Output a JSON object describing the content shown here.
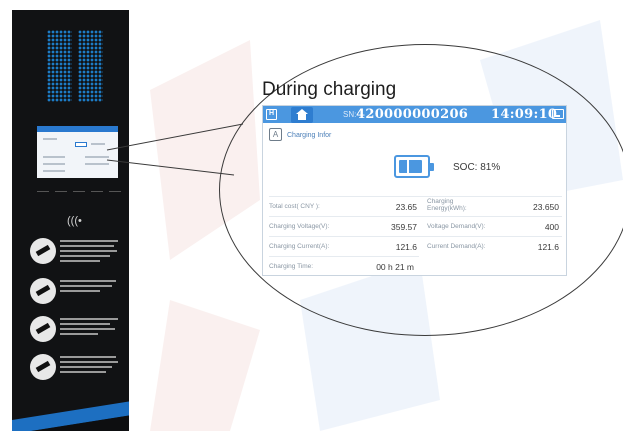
{
  "panel": {
    "instructions": [
      "step-1",
      "step-2",
      "step-3",
      "step-4"
    ]
  },
  "callout": {
    "title": "During charging"
  },
  "hmi": {
    "sn_label": "SN:",
    "serial_number": "420000000206",
    "time": "14:09:10",
    "section_title": "Charging Infor",
    "soc_label": "SOC:",
    "soc_value": "81%",
    "soc_fraction": 0.81,
    "fields": {
      "total_cost_label": "Total cost( CNY ):",
      "total_cost_value": "23.65",
      "charging_energy_label": "Charging Energy(kWh):",
      "charging_energy_value": "23.650",
      "charging_voltage_label": "Charging Voltage(V):",
      "charging_voltage_value": "359.57",
      "voltage_demand_label": "Voltage Demand(V):",
      "voltage_demand_value": "400",
      "charging_current_label": "Charging Current(A):",
      "charging_current_value": "121.6",
      "current_demand_label": "Current Demand(A):",
      "current_demand_value": "121.6",
      "charging_time_label": "Charging Time:",
      "charging_time_value": "00 h  21 m"
    }
  },
  "colors": {
    "accent": "#4b97e0",
    "panel": "#111214",
    "stripe": "#1d6fc1"
  }
}
